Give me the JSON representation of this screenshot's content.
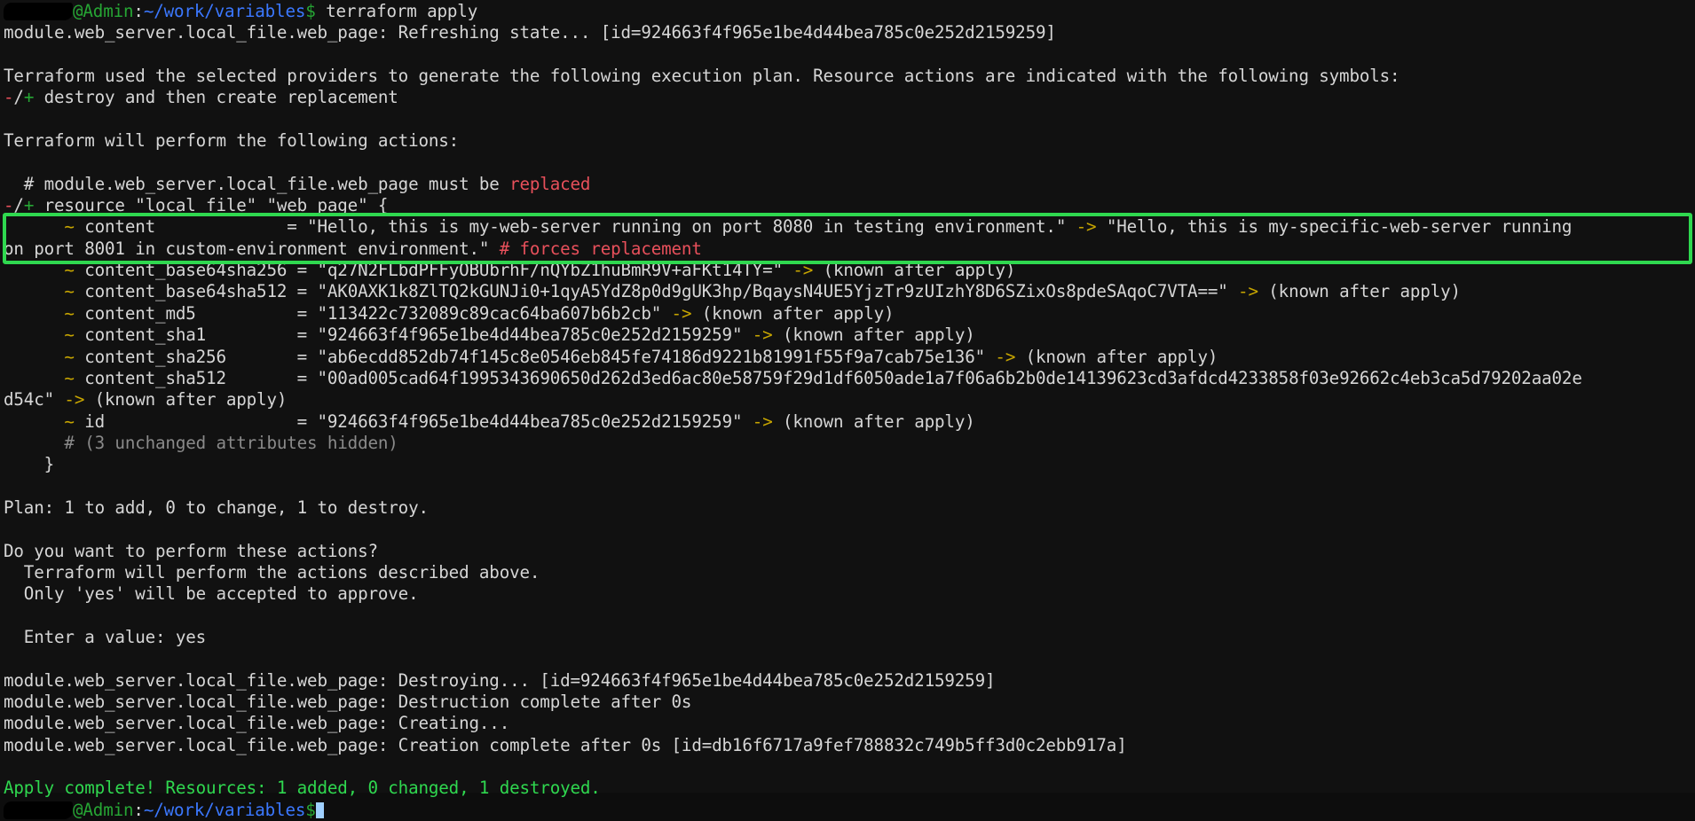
{
  "terminal": {
    "background": "#111111",
    "foreground": "#d6d6d6",
    "highlight_color": "#2fd84f",
    "prompt": {
      "user_redacted": true,
      "at_admin": "@Admin",
      "separator": ":",
      "path": "~/work/variables",
      "dollar": "$",
      "command": " terraform apply"
    },
    "lines": {
      "l01_refresh": "module.web_server.local_file.web_page: Refreshing state... [id=924663f4f965e1be4d44bea785c0e252d2159259]",
      "l02_blank": "",
      "l03_plan_intro": "Terraform used the selected providers to generate the following execution plan. Resource actions are indicated with the following symbols:",
      "l04_sym_minus": "-",
      "l04_sym_slash": "/",
      "l04_sym_plus": "+",
      "l04_sym_text": " destroy and then create replacement",
      "l05_blank": "",
      "l06_will_perform": "Terraform will perform the following actions:",
      "l07_blank": "",
      "l08_comment_pre": "  # module.web_server.local_file.web_page must be ",
      "l08_comment_replaced": "replaced",
      "l09_res_minus": "-",
      "l09_res_slash": "/",
      "l09_res_plus": "+",
      "l09_res_text": " resource \"local_file\" \"web_page\" {",
      "l10_tilde": "~",
      "l10_attr": " content",
      "l10_pad": "             = ",
      "l10_old": "\"Hello, this is my-web-server running on port 8080 in testing environment.\"",
      "l10_arrow": " -> ",
      "l10_new": "\"Hello, this is my-specific-web-server running",
      "l11_new_cont": "on port 8001 in custom-environment environment.\" ",
      "l11_forces": "# forces replacement",
      "l12_tilde": "~",
      "l12_attr": " content_base64sha256 = ",
      "l12_val": "\"q27N2FLbdPFFyOBUbrhF/nQYbZ1huBmR9V+aFKt14TY=\"",
      "l12_arrow": " -> ",
      "l12_known": "(known after apply)",
      "l13_tilde": "~",
      "l13_attr": " content_base64sha512 = ",
      "l13_val": "\"AK0AXK1k8ZlTQ2kGUNJi0+1qyA5YdZ8p0d9gUK3hp/BqaysN4UE5YjzTr9zUIzhY8D6SZixOs8pdeSAqoC7VTA==\"",
      "l13_arrow": " -> ",
      "l13_known": "(known after apply)",
      "l14_tilde": "~",
      "l14_attr": " content_md5",
      "l14_pad": "          = ",
      "l14_val": "\"113422c732089c89cac64ba607b6b2cb\"",
      "l14_arrow": " -> ",
      "l14_known": "(known after apply)",
      "l15_tilde": "~",
      "l15_attr": " content_sha1",
      "l15_pad": "         = ",
      "l15_val": "\"924663f4f965e1be4d44bea785c0e252d2159259\"",
      "l15_arrow": " -> ",
      "l15_known": "(known after apply)",
      "l16_tilde": "~",
      "l16_attr": " content_sha256",
      "l16_pad": "       = ",
      "l16_val": "\"ab6ecdd852db74f145c8e0546eb845fe74186d9221b81991f55f9a7cab75e136\"",
      "l16_arrow": " -> ",
      "l16_known": "(known after apply)",
      "l17_tilde": "~",
      "l17_attr": " content_sha512",
      "l17_pad": "       = ",
      "l17_val": "\"00ad005cad64f1995343690650d262d3ed6ac80e58759f29d1df6050ade1a7f06a6b2b0de14139623cd3afdcd4233858f03e92662c4eb3ca5d79202aa02e",
      "l18_val_cont": "d54c\"",
      "l18_arrow": " -> ",
      "l18_known": "(known after apply)",
      "l19_tilde": "~",
      "l19_attr": " id",
      "l19_pad": "                   = ",
      "l19_val": "\"924663f4f965e1be4d44bea785c0e252d2159259\"",
      "l19_arrow": " -> ",
      "l19_known": "(known after apply)",
      "l20_hidden": "      # (3 unchanged attributes hidden)",
      "l21_brace": "    }",
      "l22_blank": "",
      "l23_plan": "Plan: 1 to add, 0 to change, 1 to destroy.",
      "l24_blank": "",
      "l25_question": "Do you want to perform these actions?",
      "l26_will": "  Terraform will perform the actions described above.",
      "l27_only": "  Only 'yes' will be accepted to approve.",
      "l28_blank": "",
      "l29_enter": "  Enter a value: yes",
      "l30_blank": "",
      "l31_destroying": "module.web_server.local_file.web_page: Destroying... [id=924663f4f965e1be4d44bea785c0e252d2159259]",
      "l32_destroyed": "module.web_server.local_file.web_page: Destruction complete after 0s",
      "l33_creating": "module.web_server.local_file.web_page: Creating...",
      "l34_created": "module.web_server.local_file.web_page: Creation complete after 0s [id=db16f6717a9fef788832c749b5ff3d0c2ebb917a]",
      "l35_blank": "",
      "l36_apply_complete": "Apply complete! Resources: 1 added, 0 changed, 1 destroyed."
    }
  }
}
